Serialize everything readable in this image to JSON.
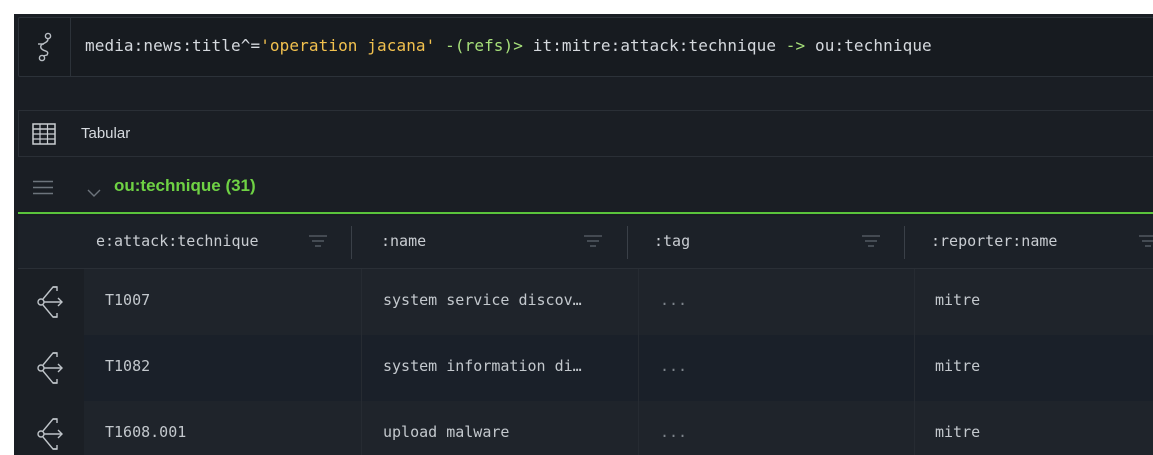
{
  "query": {
    "tokens": [
      {
        "text": "media:news:title^=",
        "kind": "plain"
      },
      {
        "text": "'operation jacana'",
        "kind": "str"
      },
      {
        "text": " -(refs)> ",
        "kind": "op"
      },
      {
        "text": "it:mitre:attack:technique",
        "kind": "plain"
      },
      {
        "text": " -> ",
        "kind": "op"
      },
      {
        "text": "ou:technique",
        "kind": "plain"
      }
    ],
    "icon": "query-node-icon"
  },
  "view": {
    "label": "Tabular",
    "icon": "table-icon"
  },
  "group": {
    "label": "ou:technique (31)",
    "accent": "#5ac43c"
  },
  "table": {
    "columns": [
      {
        "label": "e:attack:technique"
      },
      {
        "label": ":name"
      },
      {
        "label": ":tag"
      },
      {
        "label": ":reporter:name"
      }
    ],
    "rows": [
      {
        "technique": "T1007",
        "name": "system service discov…",
        "tag": "...",
        "reporter": "mitre"
      },
      {
        "technique": "T1082",
        "name": "system information di…",
        "tag": "...",
        "reporter": "mitre"
      },
      {
        "technique": "T1608.001",
        "name": "upload malware",
        "tag": "...",
        "reporter": "mitre"
      }
    ]
  }
}
